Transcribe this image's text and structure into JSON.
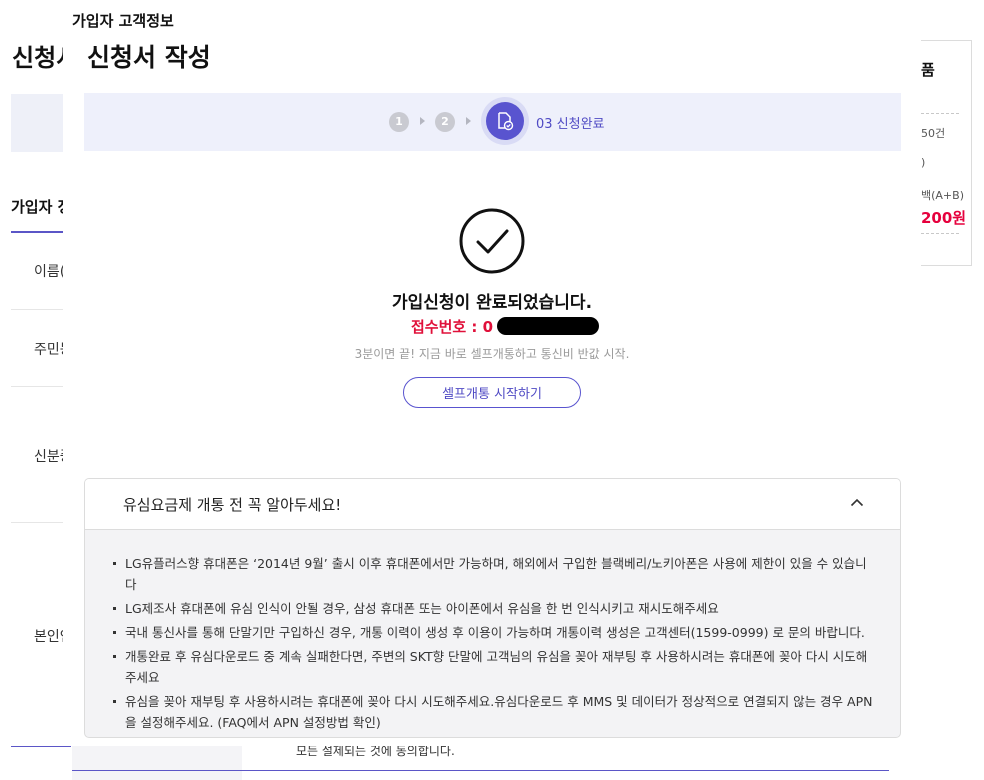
{
  "background": {
    "title_fragment": "신청서",
    "section_fragment": "가입자 정",
    "row_labels": [
      "이름(",
      "주민등",
      "신분증",
      "본인인"
    ],
    "summary": {
      "title_fragment": "품",
      "line1": "50건",
      "line2": ")",
      "line3": "백(A+B)",
      "price_fragment": "200원"
    },
    "footer_text": "모든 설제되는 것에 동의합니다."
  },
  "modal": {
    "breadcrumb": "가입자 고객정보",
    "heading": "신청서 작성",
    "steps": {
      "step1": "1",
      "step2": "2",
      "active_label": "03 신청완료"
    },
    "complete_message": "가입신청이 완료되었습니다.",
    "receipt_label": "접수번호 : 0",
    "sub_message": "3분이면 끝! 지금 바로 셀프개통하고 통신비 반값 시작.",
    "self_activation_button": "셀프개통 시작하기",
    "notice": {
      "title": "유심요금제 개통 전 꼭 알아두세요!",
      "items": [
        "LG유플러스향 휴대폰은 ‘2014년 9월’ 출시 이후 휴대폰에서만 가능하며, 해외에서 구입한 블랙베리/노키아폰은 사용에 제한이 있을 수 있습니다",
        "LG제조사 휴대폰에 유심 인식이 안될 경우, 삼성 휴대폰 또는 아이폰에서 유심을 한 번 인식시키고 재시도해주세요",
        "국내 통신사를 통해 단말기만 구입하신 경우, 개통 이력이 생성 후 이용이 가능하며 개통이력 생성은 고객센터(1599-0999) 로 문의 바랍니다.",
        "개통완료 후 유심다운로드 중 계속 실패한다면, 주변의 SKT향 단말에 고객님의 유심을 꽂아 재부팅 후 사용하시려는 휴대폰에 꽂아 다시 시도해주세요",
        "유심을 꽂아 재부팅 후 사용하시려는 휴대폰에 꽂아 다시 시도해주세요.유심다운로드 후 MMS 및 데이터가 정상적으로 연결되지 않는 경우 APN을 설정해주세요. (FAQ에서 APN 설정방법 확인)"
      ]
    }
  },
  "colors": {
    "accent": "#5954cf",
    "receipt_red": "#e0103a",
    "step_bar_bg": "#eef0fb"
  },
  "icons": {
    "step_active": "document-check-icon",
    "complete": "check-circle-icon",
    "collapse": "chevron-up-icon"
  }
}
